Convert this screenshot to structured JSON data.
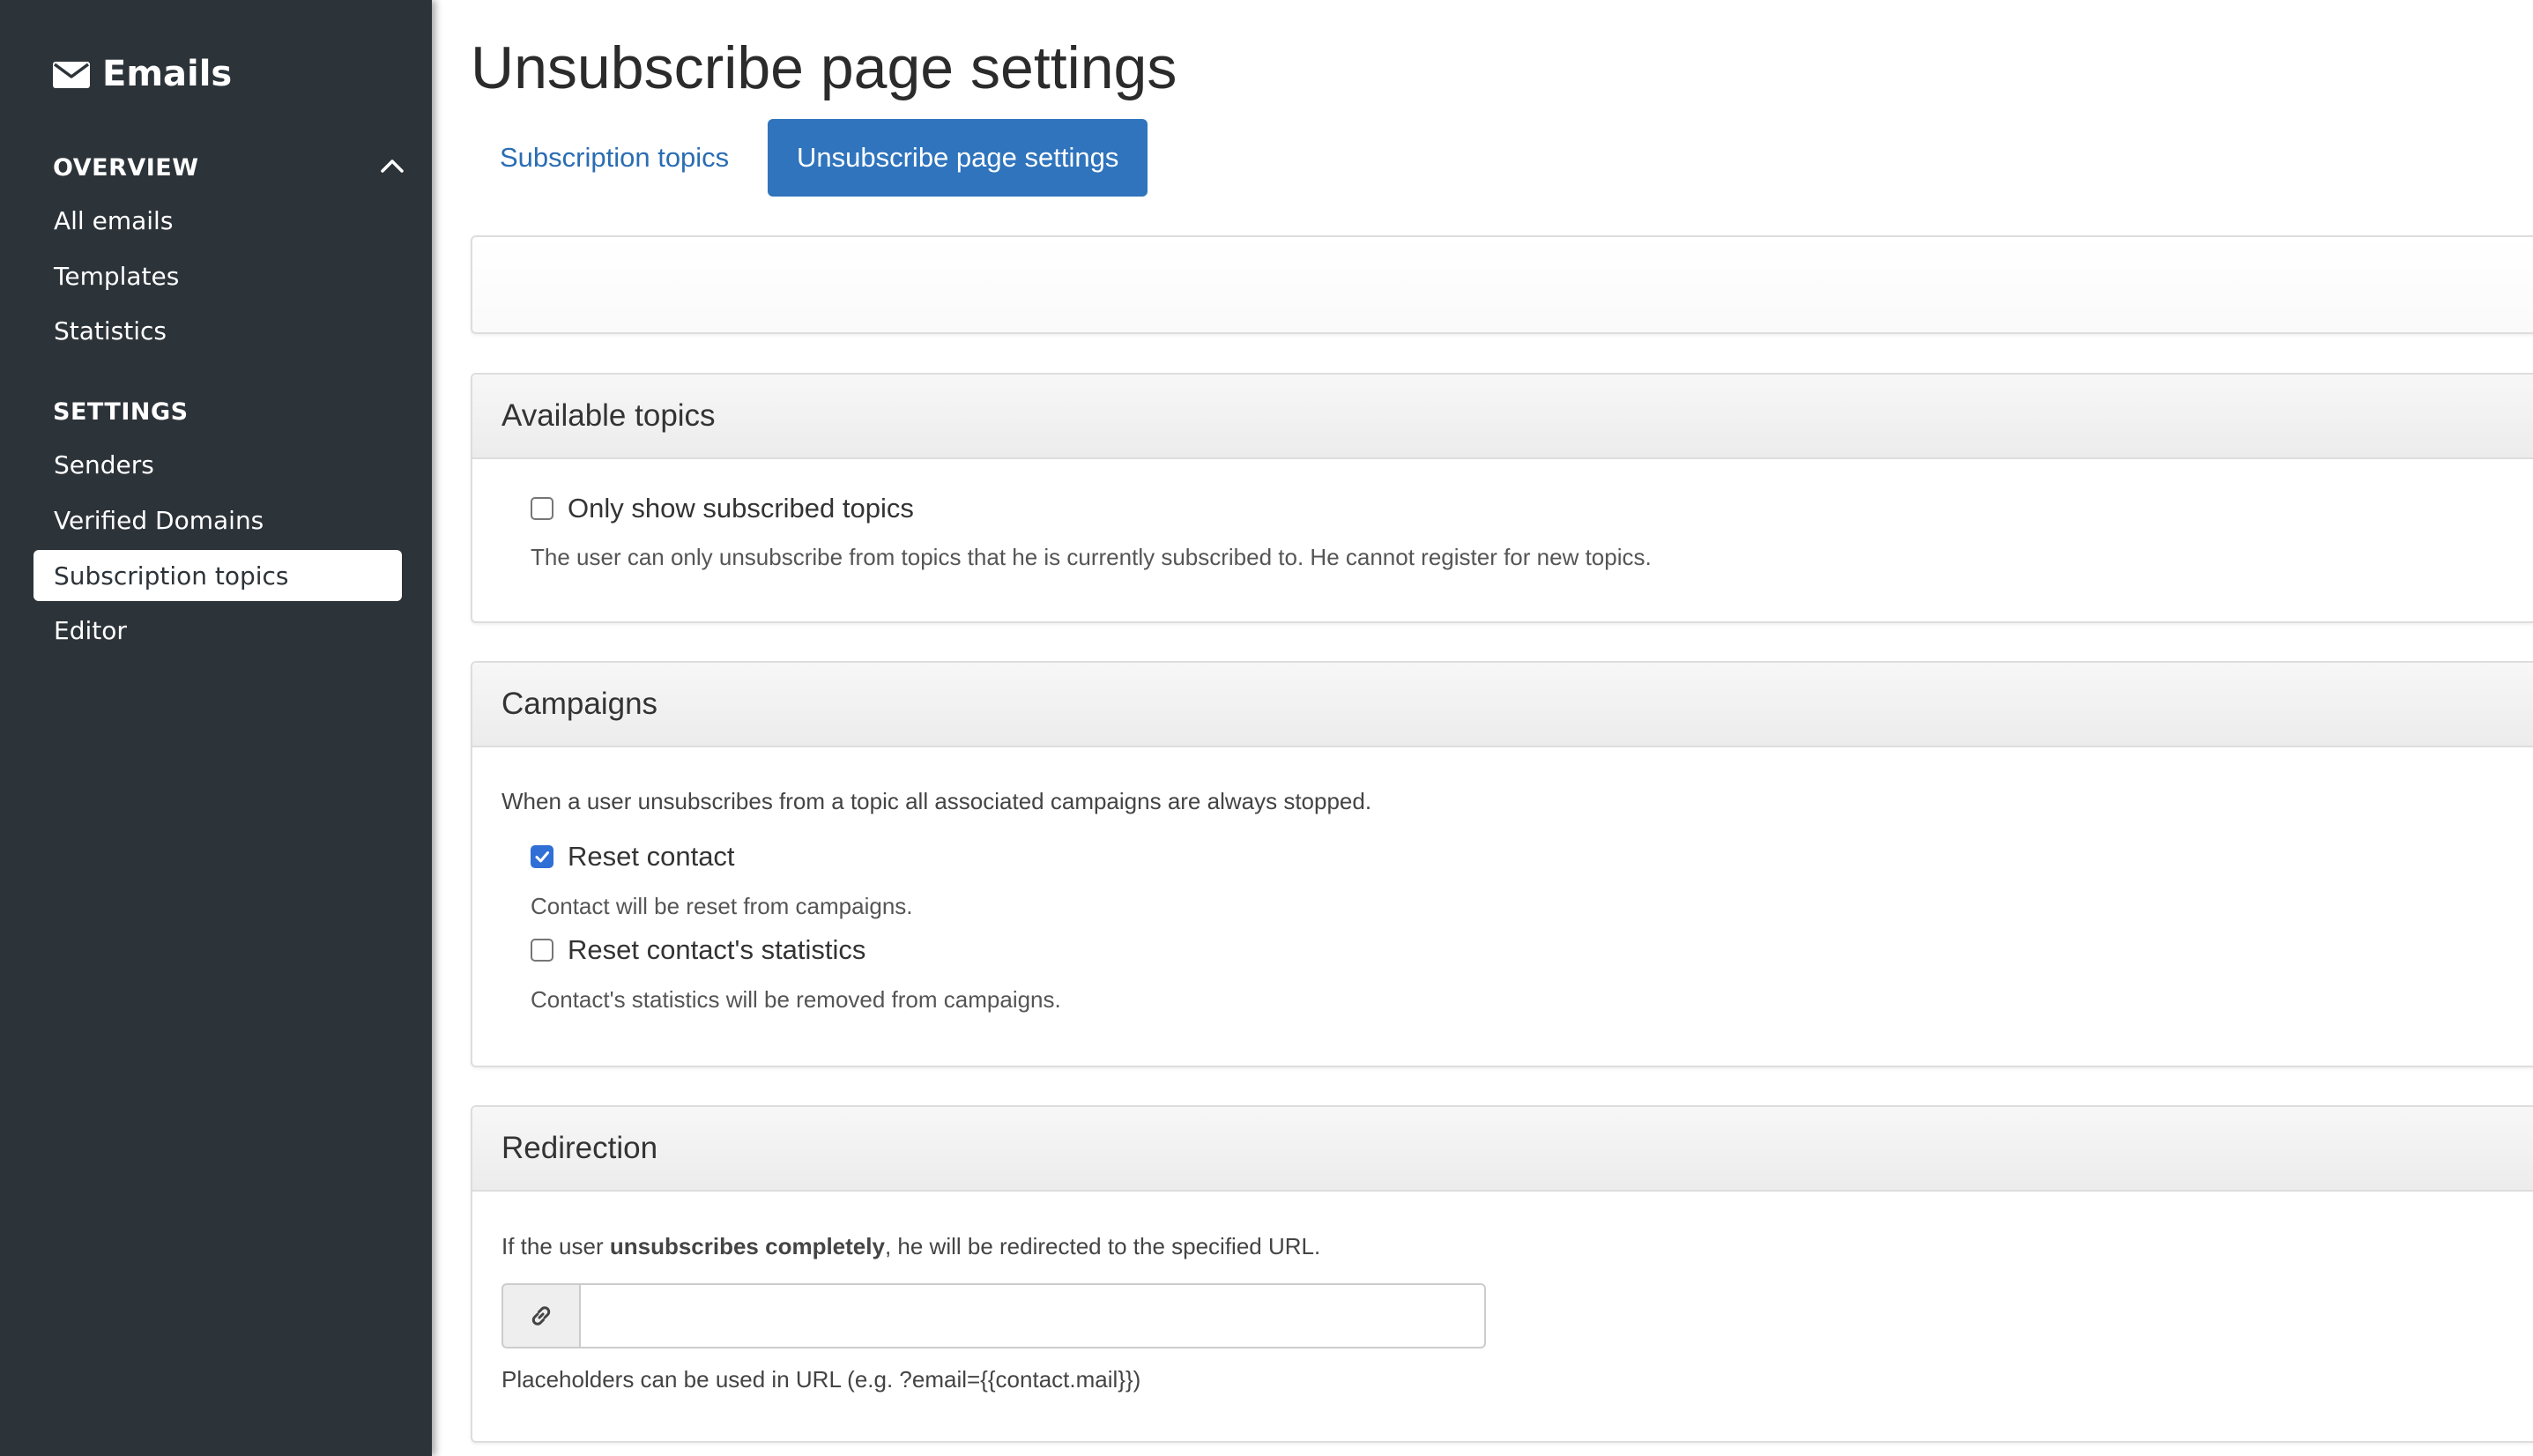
{
  "sidebar": {
    "title": "Emails",
    "sections": [
      {
        "heading": "OVERVIEW",
        "items": [
          "All emails",
          "Templates",
          "Statistics"
        ]
      },
      {
        "heading": "SETTINGS",
        "items": [
          "Senders",
          "Verified Domains",
          "Subscription topics",
          "Editor"
        ]
      }
    ],
    "active_item": "Subscription topics"
  },
  "page": {
    "title": "Unsubscribe page settings",
    "tabs": [
      {
        "label": "Subscription topics",
        "active": false
      },
      {
        "label": "Unsubscribe page settings",
        "active": true
      }
    ]
  },
  "available_topics": {
    "heading": "Available topics",
    "option_label": "Only show subscribed topics",
    "option_checked": false,
    "option_help": "The user can only unsubscribe from topics that he is currently subscribed to. He cannot register for new topics."
  },
  "campaigns": {
    "heading": "Campaigns",
    "description": "When a user unsubscribes from a topic all associated campaigns are always stopped.",
    "reset_contact_label": "Reset contact",
    "reset_contact_checked": true,
    "reset_contact_help": "Contact will be reset from campaigns.",
    "reset_stats_label": "Reset contact's statistics",
    "reset_stats_checked": false,
    "reset_stats_help": "Contact's statistics will be removed from campaigns."
  },
  "redirection": {
    "heading": "Redirection",
    "desc_prefix": "If the user ",
    "desc_bold": "unsubscribes completely",
    "desc_suffix": ", he will be redirected to the specified URL.",
    "url_value": "",
    "url_placeholder": "",
    "help": "Placeholders can be used in URL (e.g. ?email={{contact.mail}})"
  },
  "icons": {
    "brand": "envelope-icon",
    "collapse": "chevron-up-icon",
    "url_addon": "link-icon"
  },
  "colors": {
    "sidebar_bg": "#2c3339",
    "accent": "#2f74bd",
    "link": "#2a6db3",
    "checkbox_checked": "#2f6fd6"
  }
}
